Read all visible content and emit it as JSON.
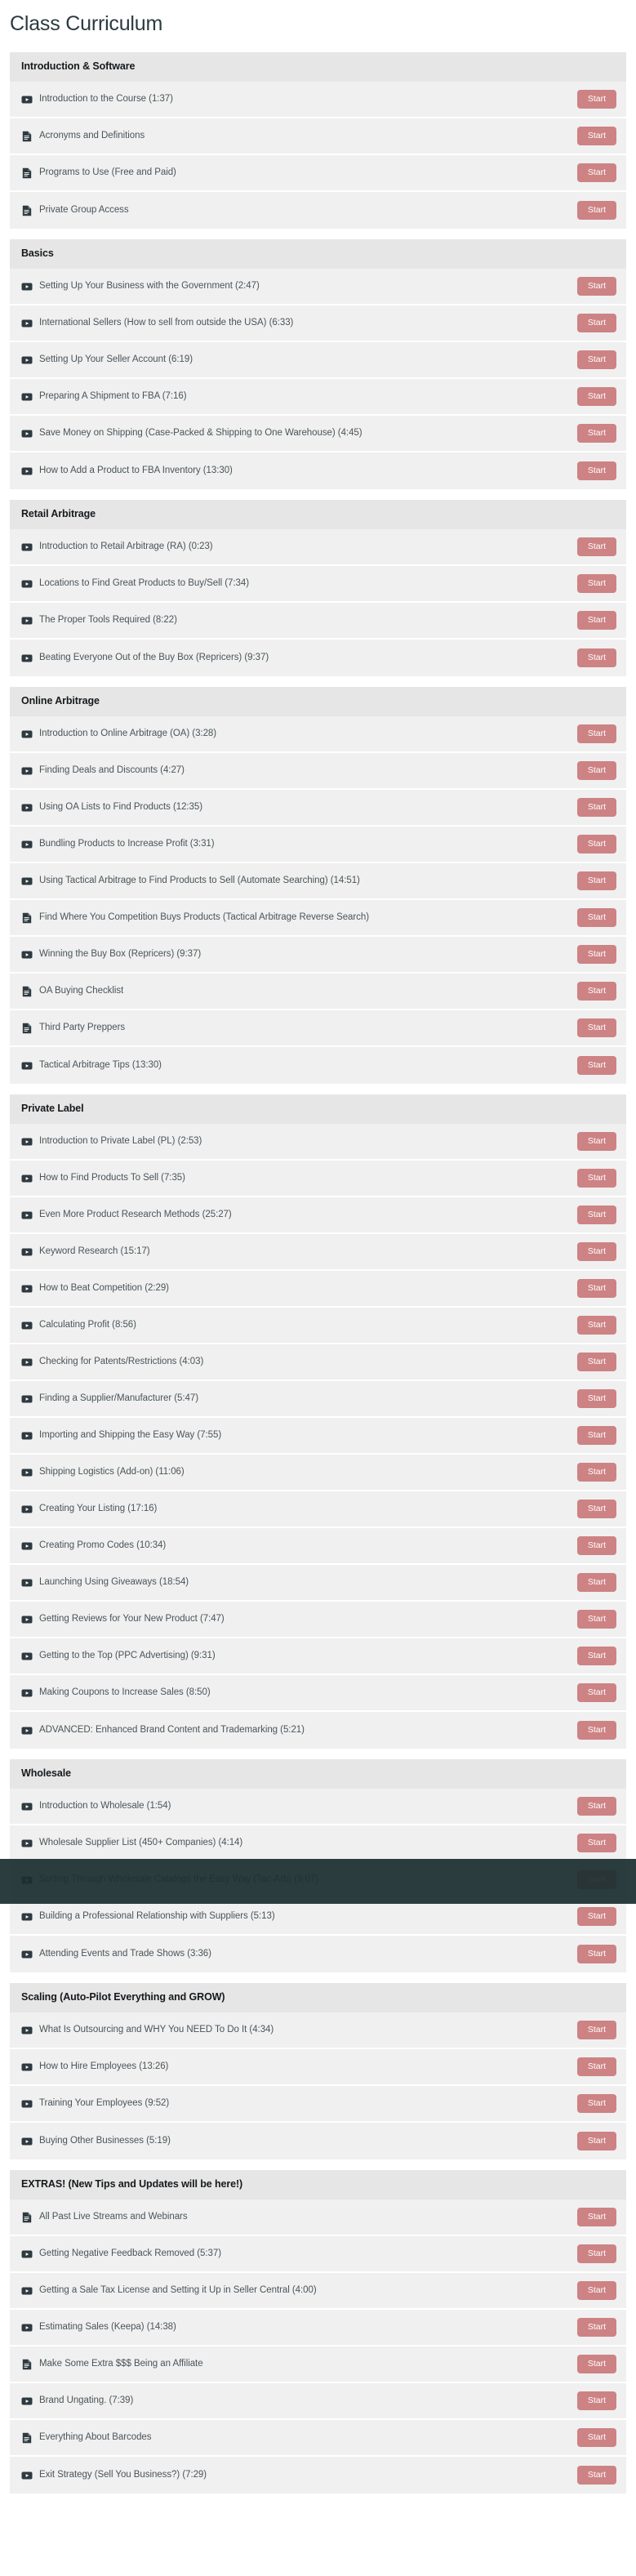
{
  "page": {
    "title": "Class Curriculum",
    "start_label": "Start",
    "accent_color": "#cd8284",
    "section_header_bg": "#e6e6e6",
    "row_bg": "#f0f0f0",
    "overlay_color": "#1c2e30"
  },
  "sections": [
    {
      "title": "Introduction & Software",
      "lessons": [
        {
          "icon": "video-icon",
          "title": "Introduction to the Course (1:37)",
          "action": "Start"
        },
        {
          "icon": "document-icon",
          "title": "Acronyms and Definitions",
          "action": "Start"
        },
        {
          "icon": "document-icon",
          "title": "Programs to Use (Free and Paid)",
          "action": "Start"
        },
        {
          "icon": "document-icon",
          "title": "Private Group Access",
          "action": "Start"
        }
      ]
    },
    {
      "title": "Basics",
      "lessons": [
        {
          "icon": "video-icon",
          "title": "Setting Up Your Business with the Government (2:47)",
          "action": "Start"
        },
        {
          "icon": "video-icon",
          "title": "International Sellers (How to sell from outside the USA) (6:33)",
          "action": "Start"
        },
        {
          "icon": "video-icon",
          "title": "Setting Up Your Seller Account (6:19)",
          "action": "Start"
        },
        {
          "icon": "video-icon",
          "title": "Preparing A Shipment to FBA (7:16)",
          "action": "Start"
        },
        {
          "icon": "video-icon",
          "title": "Save Money on Shipping (Case-Packed & Shipping to One Warehouse) (4:45)",
          "action": "Start"
        },
        {
          "icon": "video-icon",
          "title": "How to Add a Product to FBA Inventory (13:30)",
          "action": "Start"
        }
      ]
    },
    {
      "title": "Retail Arbitrage",
      "lessons": [
        {
          "icon": "video-icon",
          "title": "Introduction to Retail Arbitrage (RA) (0:23)",
          "action": "Start"
        },
        {
          "icon": "video-icon",
          "title": "Locations to Find Great Products to Buy/Sell (7:34)",
          "action": "Start"
        },
        {
          "icon": "video-icon",
          "title": "The Proper Tools Required (8:22)",
          "action": "Start"
        },
        {
          "icon": "video-icon",
          "title": "Beating Everyone Out of the Buy Box (Repricers) (9:37)",
          "action": "Start"
        }
      ]
    },
    {
      "title": "Online Arbitrage",
      "lessons": [
        {
          "icon": "video-icon",
          "title": "Introduction to Online Arbitrage (OA) (3:28)",
          "action": "Start"
        },
        {
          "icon": "video-icon",
          "title": "Finding Deals and Discounts (4:27)",
          "action": "Start"
        },
        {
          "icon": "video-icon",
          "title": "Using OA Lists to Find Products (12:35)",
          "action": "Start"
        },
        {
          "icon": "video-icon",
          "title": "Bundling Products to Increase Profit (3:31)",
          "action": "Start"
        },
        {
          "icon": "video-icon",
          "title": "Using Tactical Arbitrage to Find Products to Sell (Automate Searching) (14:51)",
          "action": "Start"
        },
        {
          "icon": "document-icon",
          "title": "Find Where You Competition Buys Products (Tactical Arbitrage Reverse Search)",
          "action": "Start"
        },
        {
          "icon": "video-icon",
          "title": "Winning the Buy Box (Repricers) (9:37)",
          "action": "Start"
        },
        {
          "icon": "document-icon",
          "title": "OA Buying Checklist",
          "action": "Start"
        },
        {
          "icon": "document-icon",
          "title": "Third Party Preppers",
          "action": "Start"
        },
        {
          "icon": "video-icon",
          "title": "Tactical Arbitrage Tips (13:30)",
          "action": "Start"
        }
      ]
    },
    {
      "title": "Private Label",
      "lessons": [
        {
          "icon": "video-icon",
          "title": "Introduction to Private Label (PL) (2:53)",
          "action": "Start"
        },
        {
          "icon": "video-icon",
          "title": "How to Find Products To Sell (7:35)",
          "action": "Start"
        },
        {
          "icon": "video-icon",
          "title": "Even More Product Research Methods (25:27)",
          "action": "Start"
        },
        {
          "icon": "video-icon",
          "title": "Keyword Research (15:17)",
          "action": "Start"
        },
        {
          "icon": "video-icon",
          "title": "How to Beat Competition (2:29)",
          "action": "Start"
        },
        {
          "icon": "video-icon",
          "title": "Calculating Profit (8:56)",
          "action": "Start"
        },
        {
          "icon": "video-icon",
          "title": "Checking for Patents/Restrictions (4:03)",
          "action": "Start"
        },
        {
          "icon": "video-icon",
          "title": "Finding a Supplier/Manufacturer (5:47)",
          "action": "Start"
        },
        {
          "icon": "video-icon",
          "title": "Importing and Shipping the Easy Way (7:55)",
          "action": "Start"
        },
        {
          "icon": "video-icon",
          "title": "Shipping Logistics (Add-on) (11:06)",
          "action": "Start"
        },
        {
          "icon": "video-icon",
          "title": "Creating Your Listing (17:16)",
          "action": "Start"
        },
        {
          "icon": "video-icon",
          "title": "Creating Promo Codes (10:34)",
          "action": "Start"
        },
        {
          "icon": "video-icon",
          "title": "Launching Using Giveaways (18:54)",
          "action": "Start"
        },
        {
          "icon": "video-icon",
          "title": "Getting Reviews for Your New Product (7:47)",
          "action": "Start"
        },
        {
          "icon": "video-icon",
          "title": "Getting to the Top (PPC Advertising) (9:31)",
          "action": "Start"
        },
        {
          "icon": "video-icon",
          "title": "Making Coupons to Increase Sales (8:50)",
          "action": "Start"
        },
        {
          "icon": "video-icon",
          "title": "ADVANCED: Enhanced Brand Content and Trademarking (5:21)",
          "action": "Start"
        }
      ]
    },
    {
      "title": "Wholesale",
      "lessons": [
        {
          "icon": "video-icon",
          "title": "Introduction to Wholesale (1:54)",
          "action": "Start"
        },
        {
          "icon": "video-icon",
          "title": "Wholesale Supplier List (450+ Companies) (4:14)",
          "action": "Start"
        },
        {
          "icon": "video-icon",
          "title": "Sorting Through Wholesale Catalogs the Easy Way (Tac-Arb) (9:07)",
          "action": "Start",
          "obscured": true
        },
        {
          "icon": "video-icon",
          "title": "Building a Professional Relationship with Suppliers (5:13)",
          "action": "Start"
        },
        {
          "icon": "video-icon",
          "title": "Attending Events and Trade Shows (3:36)",
          "action": "Start"
        }
      ]
    },
    {
      "title": "Scaling (Auto-Pilot Everything and GROW)",
      "lessons": [
        {
          "icon": "video-icon",
          "title": "What Is Outsourcing and WHY You NEED To Do It (4:34)",
          "action": "Start"
        },
        {
          "icon": "video-icon",
          "title": "How to Hire Employees (13:26)",
          "action": "Start"
        },
        {
          "icon": "video-icon",
          "title": "Training Your Employees (9:52)",
          "action": "Start"
        },
        {
          "icon": "video-icon",
          "title": "Buying Other Businesses (5:19)",
          "action": "Start"
        }
      ]
    },
    {
      "title": "EXTRAS! (New Tips and Updates will be here!)",
      "lessons": [
        {
          "icon": "document-icon",
          "title": "All Past Live Streams and Webinars",
          "action": "Start"
        },
        {
          "icon": "video-icon",
          "title": "Getting Negative Feedback Removed (5:37)",
          "action": "Start"
        },
        {
          "icon": "video-icon",
          "title": "Getting a Sale Tax License and Setting it Up in Seller Central (4:00)",
          "action": "Start"
        },
        {
          "icon": "video-icon",
          "title": "Estimating Sales (Keepa) (14:38)",
          "action": "Start"
        },
        {
          "icon": "document-icon",
          "title": "Make Some Extra $$$ Being an Affiliate",
          "action": "Start"
        },
        {
          "icon": "video-icon",
          "title": "Brand Ungating. (7:39)",
          "action": "Start"
        },
        {
          "icon": "document-icon",
          "title": "Everything About Barcodes",
          "action": "Start"
        },
        {
          "icon": "video-icon",
          "title": "Exit Strategy (Sell You Business?) (7:29)",
          "action": "Start"
        }
      ]
    }
  ]
}
